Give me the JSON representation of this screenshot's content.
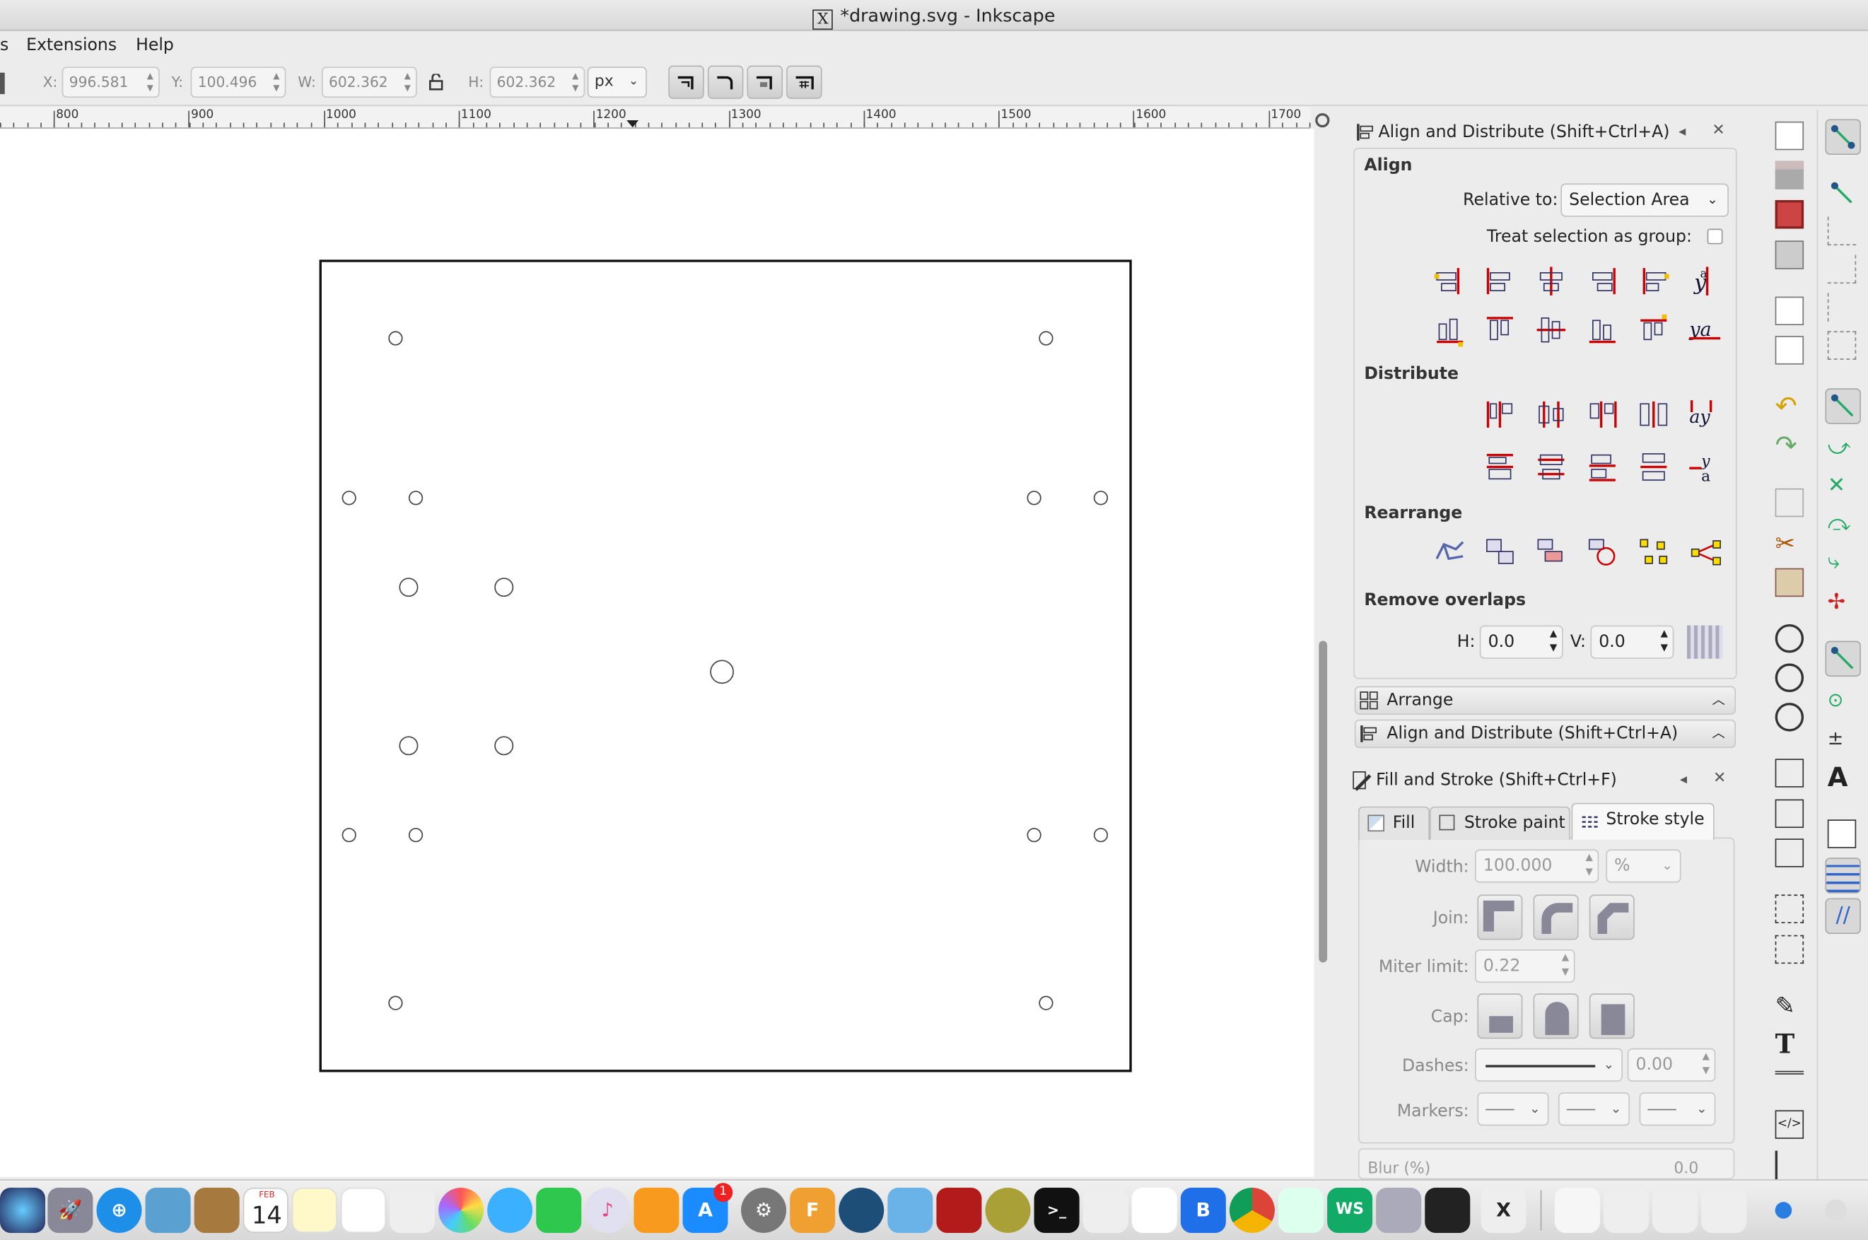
{
  "window": {
    "title": "*drawing.svg - Inkscape"
  },
  "menu": {
    "items": [
      "s",
      "Extensions",
      "Help"
    ]
  },
  "toolbar": {
    "x_label": "X:",
    "x_value": "996.581",
    "y_label": "Y:",
    "y_value": "100.496",
    "w_label": "W:",
    "w_value": "602.362",
    "h_label": "H:",
    "h_value": "602.362",
    "unit": "px"
  },
  "ruler": {
    "labels": [
      "800",
      "900",
      "1000",
      "1100",
      "1200",
      "1300",
      "1400",
      "1500",
      "1600",
      "1700"
    ]
  },
  "align_panel": {
    "title": "Align and Distribute (Shift+Ctrl+A)",
    "align_heading": "Align",
    "relative_to_label": "Relative to:",
    "relative_to_value": "Selection Area",
    "treat_group_label": "Treat selection as group:",
    "distribute_heading": "Distribute",
    "rearrange_heading": "Rearrange",
    "remove_overlaps_heading": "Remove overlaps",
    "h_label": "H:",
    "h_value": "0.0",
    "v_label": "V:",
    "v_value": "0.0"
  },
  "collapsed": {
    "arrange": "Arrange",
    "align": "Align and Distribute (Shift+Ctrl+A)"
  },
  "fill_stroke": {
    "title": "Fill and Stroke (Shift+Ctrl+F)",
    "tabs": [
      "Fill",
      "Stroke paint",
      "Stroke style"
    ],
    "width_label": "Width:",
    "width_value": "100.000",
    "width_unit": "%",
    "join_label": "Join:",
    "miter_label": "Miter limit:",
    "miter_value": "0.22",
    "cap_label": "Cap:",
    "dashes_label": "Dashes:",
    "dashes_value": "0.00",
    "markers_label": "Markers:",
    "blur_label": "Blur (%)",
    "blur_value": "0.0"
  },
  "dock": {
    "calendar_month": "FEB",
    "calendar_day": "14",
    "appstore_badge": "1"
  }
}
